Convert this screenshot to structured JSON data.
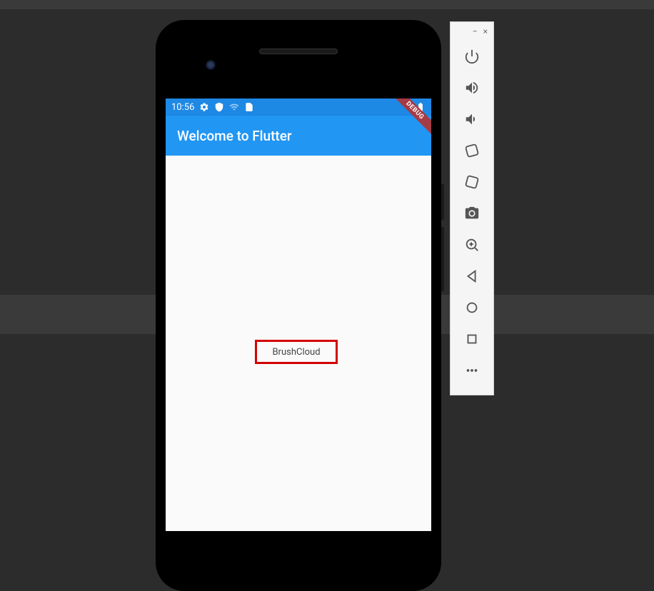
{
  "status_bar": {
    "time": "10:56"
  },
  "app_bar": {
    "title": "Welcome to Flutter"
  },
  "debug_banner_text": "DEBUG",
  "body_text": "BrushCloud"
}
